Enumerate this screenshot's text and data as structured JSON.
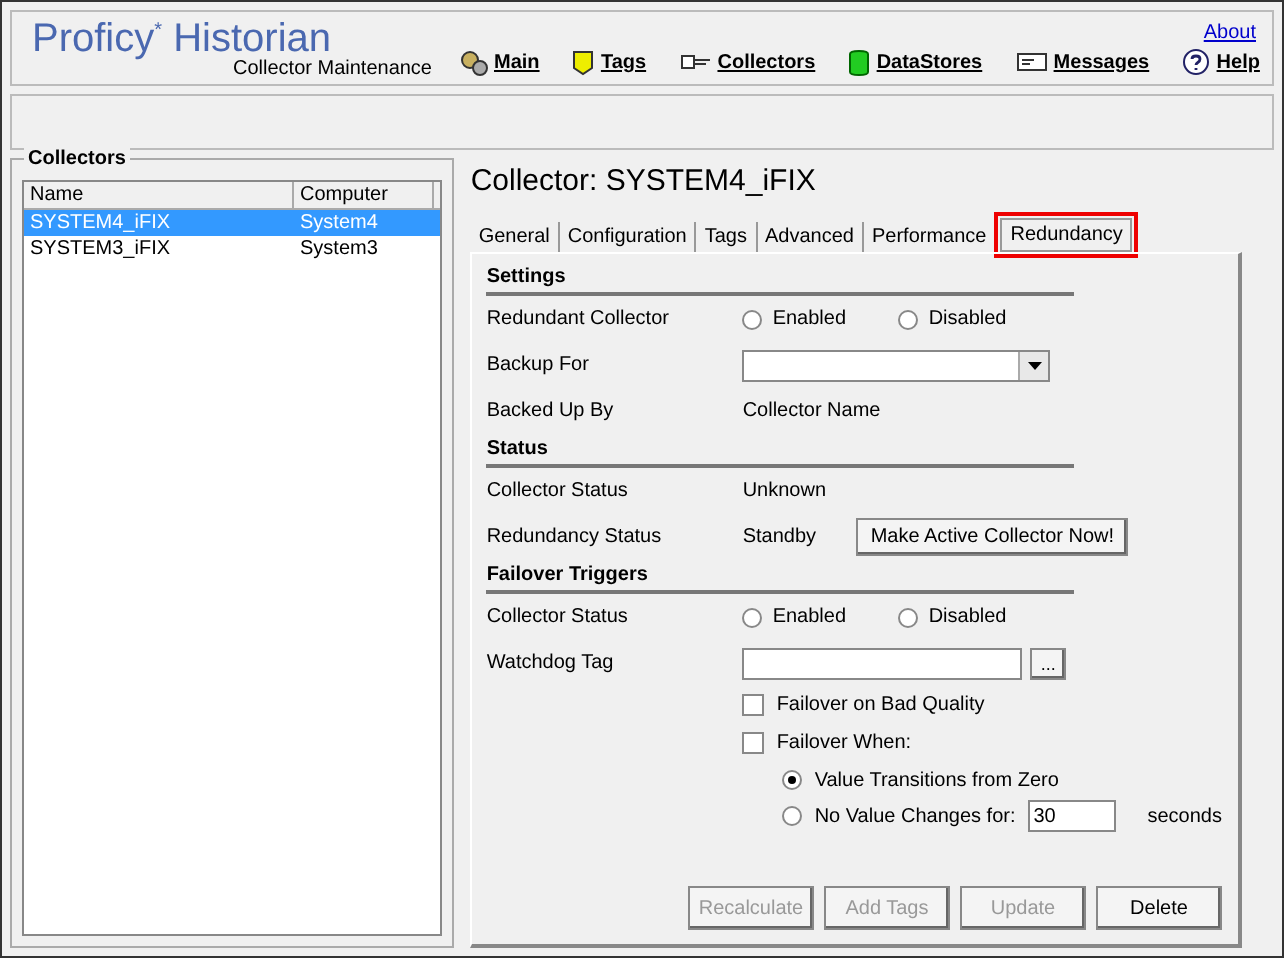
{
  "header": {
    "product": "Proficy",
    "product_mark": "*",
    "product_rest": "Historian",
    "subtitle": "Collector Maintenance",
    "about": "About",
    "nav": [
      {
        "label": "Main",
        "kind": "main"
      },
      {
        "label": "Tags",
        "kind": "tags"
      },
      {
        "label": "Collectors",
        "kind": "collectors"
      },
      {
        "label": "DataStores",
        "kind": "datastores"
      },
      {
        "label": "Messages",
        "kind": "messages"
      },
      {
        "label": "Help",
        "kind": "help"
      }
    ]
  },
  "collectors": {
    "title": "Collectors",
    "columns": [
      "Name",
      "Computer"
    ],
    "rows": [
      {
        "name": "SYSTEM4_iFIX",
        "computer": "System4",
        "selected": true
      },
      {
        "name": "SYSTEM3_iFIX",
        "computer": "System3",
        "selected": false
      }
    ]
  },
  "detail": {
    "title": "Collector: SYSTEM4_iFIX",
    "tabs": [
      {
        "label": "General",
        "selected": false,
        "highlighted": false
      },
      {
        "label": "Configuration",
        "selected": false,
        "highlighted": false
      },
      {
        "label": "Tags",
        "selected": false,
        "highlighted": false
      },
      {
        "label": "Advanced",
        "selected": false,
        "highlighted": false
      },
      {
        "label": "Performance",
        "selected": false,
        "highlighted": false
      },
      {
        "label": "Redundancy",
        "selected": true,
        "highlighted": true
      }
    ],
    "sections": [
      {
        "title": "Settings",
        "rows": [
          {
            "kind": "radios",
            "label": "Redundant Collector",
            "options": [
              {
                "label": "Enabled",
                "selected": false
              },
              {
                "label": "Disabled",
                "selected": false
              }
            ]
          },
          {
            "kind": "dropdown",
            "label": "Backup For"
          },
          {
            "kind": "text",
            "label": "Backed Up By",
            "value": "Collector Name"
          }
        ]
      },
      {
        "title": "Status",
        "rows": [
          {
            "kind": "text",
            "label": "Collector Status",
            "value": "Unknown"
          },
          {
            "kind": "text_button",
            "label": "Redundancy Status",
            "value": "Standby",
            "button": "Make Active Collector Now!"
          }
        ]
      },
      {
        "title": "Failover Triggers",
        "rows": [
          {
            "kind": "radios",
            "label": "Collector Status",
            "options": [
              {
                "label": "Enabled",
                "selected": false
              },
              {
                "label": "Disabled",
                "selected": false
              }
            ]
          },
          {
            "kind": "browse",
            "label": "Watchdog Tag",
            "button": "..."
          }
        ]
      }
    ],
    "failover_bad_quality": {
      "label": "Failover on Bad Quality",
      "checked": false
    },
    "failover_when": {
      "label": "Failover When:",
      "checked": false,
      "options": [
        {
          "label": "Value Transitions from Zero",
          "selected": true
        },
        {
          "label": "No Value Changes for:",
          "selected": false,
          "value": "30",
          "unit": "seconds"
        }
      ]
    },
    "buttons": [
      {
        "label": "Recalculate",
        "disabled": true
      },
      {
        "label": "Add Tags",
        "disabled": true
      },
      {
        "label": "Update",
        "disabled": true
      },
      {
        "label": "Delete",
        "disabled": false
      }
    ]
  }
}
